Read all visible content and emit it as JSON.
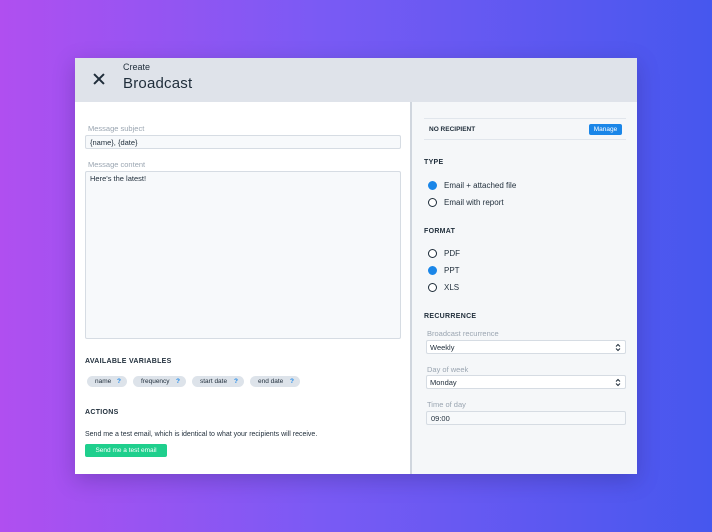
{
  "header": {
    "kicker": "Create",
    "title": "Broadcast"
  },
  "left": {
    "subject": {
      "label": "Message subject",
      "value": "{name}, {date}"
    },
    "content": {
      "label": "Message content",
      "value": "Here's the latest!"
    },
    "variables": {
      "heading": "AVAILABLE VARIABLES",
      "items": [
        {
          "label": "name",
          "help": "?"
        },
        {
          "label": "frequency",
          "help": "?"
        },
        {
          "label": "start date",
          "help": "?"
        },
        {
          "label": "end date",
          "help": "?"
        }
      ]
    },
    "actions": {
      "heading": "ACTIONS",
      "description": "Send me a test email, which is identical to what your recipients will receive.",
      "button_label": "Send me a test email"
    }
  },
  "right": {
    "recipient": {
      "label": "NO RECIPIENT",
      "button_label": "Manage"
    },
    "type": {
      "heading": "TYPE",
      "options": [
        {
          "label": "Email + attached file",
          "checked": true
        },
        {
          "label": "Email with report",
          "checked": false
        }
      ]
    },
    "format": {
      "heading": "FORMAT",
      "options": [
        {
          "label": "PDF",
          "checked": false
        },
        {
          "label": "PPT",
          "checked": true
        },
        {
          "label": "XLS",
          "checked": false
        }
      ]
    },
    "recurrence": {
      "heading": "RECURRENCE",
      "broadcast_recurrence": {
        "label": "Broadcast recurrence",
        "value": "Weekly"
      },
      "day_of_week": {
        "label": "Day of week",
        "value": "Monday"
      },
      "time_of_day": {
        "label": "Time of day",
        "value": "09:00"
      }
    }
  },
  "colors": {
    "accent": "#1a86e8",
    "success": "#1fcf8d",
    "header_bg": "#dfe3ea"
  },
  "icons": {
    "close": "close-icon",
    "select_chevron": "chevron-updown-icon",
    "help": "question-mark"
  }
}
